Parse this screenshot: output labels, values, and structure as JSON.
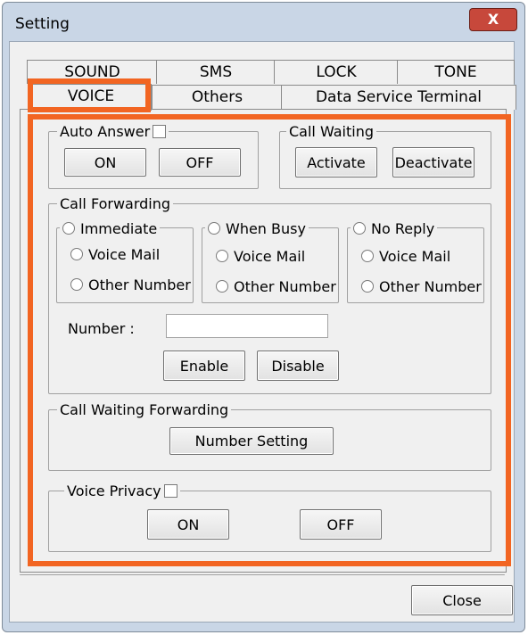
{
  "window": {
    "title": "Setting",
    "close_glyph": "X"
  },
  "tabs_row1": [
    "SOUND",
    "SMS",
    "LOCK",
    "TONE"
  ],
  "tabs_row2": [
    "VOICE",
    "Others",
    "Data Service Terminal"
  ],
  "active_tab": "VOICE",
  "auto_answer": {
    "label": "Auto Answer",
    "checked": false,
    "on_label": "ON",
    "off_label": "OFF"
  },
  "call_waiting": {
    "label": "Call Waiting",
    "activate_label": "Activate",
    "deactivate_label": "Deactivate"
  },
  "call_forwarding": {
    "label": "Call Forwarding",
    "modes": [
      {
        "label": "Immediate",
        "options": [
          "Voice Mail",
          "Other Number"
        ]
      },
      {
        "label": "When Busy",
        "options": [
          "Voice Mail",
          "Other Number"
        ]
      },
      {
        "label": "No Reply",
        "options": [
          "Voice Mail",
          "Other Number"
        ]
      }
    ],
    "number_label": "Number :",
    "number_value": "",
    "enable_label": "Enable",
    "disable_label": "Disable"
  },
  "call_waiting_forwarding": {
    "label": "Call Waiting  Forwarding",
    "number_setting_label": "Number Setting"
  },
  "voice_privacy": {
    "label": "Voice Privacy",
    "checked": false,
    "on_label": "ON",
    "off_label": "OFF"
  },
  "footer": {
    "close_label": "Close"
  },
  "colors": {
    "highlight": "#f26522",
    "frame": "#c9d6e6",
    "close_button": "#c7483b"
  }
}
